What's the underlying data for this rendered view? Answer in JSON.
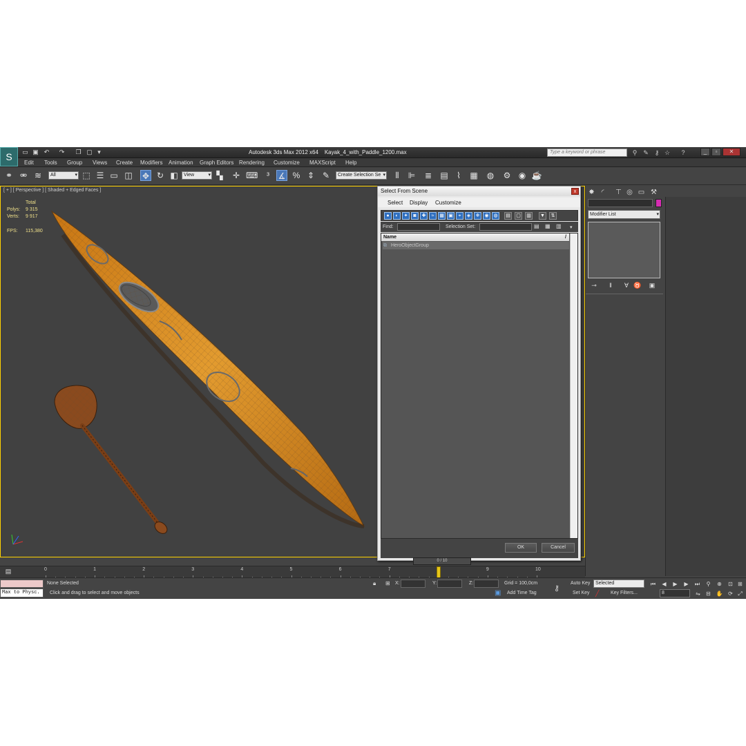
{
  "window": {
    "app_title": "Autodesk 3ds Max  2012 x64",
    "file_name": "Kayak_4_with_Paddle_1200.max",
    "search_placeholder": "Type a keyword or phrase"
  },
  "menus": [
    "Edit",
    "Tools",
    "Group",
    "Views",
    "Create",
    "Modifiers",
    "Animation",
    "Graph Editors",
    "Rendering",
    "Customize",
    "MAXScript",
    "Help"
  ],
  "toolbar": {
    "filter_value": "All",
    "coord_system": "View",
    "selection_set_value": "Create Selection Se"
  },
  "viewport": {
    "label": "[ + ] [ Perspective ] [ Shaded + Edged Faces ]",
    "stats": {
      "total_label": "Total",
      "polys_label": "Polys:",
      "polys_value": "9 315",
      "verts_label": "Verts:",
      "verts_value": "9 917",
      "fps_label": "FPS:",
      "fps_value": "115,380"
    }
  },
  "dialog": {
    "title": "Select From Scene",
    "close_label": "x",
    "menus": [
      "Select",
      "Display",
      "Customize"
    ],
    "find_label": "Find:",
    "selection_set_label": "Selection Set:",
    "column_name": "Name",
    "column_sort": "/",
    "rows": [
      "HeroObjectGroup"
    ],
    "ok_label": "OK",
    "cancel_label": "Cancel"
  },
  "command_panel": {
    "modifier_list": "Modifier List"
  },
  "timeline": {
    "slider_label": "0 / 10",
    "ticks": [
      "0",
      "1",
      "2",
      "3",
      "4",
      "5",
      "6",
      "7",
      "8",
      "9",
      "10"
    ],
    "current_frame": 8
  },
  "statusbar": {
    "maxscript_line": "Max to Physc.",
    "selection": "None Selected",
    "prompt": "Click and drag to select and move objects",
    "x_label": "X:",
    "y_label": "Y:",
    "z_label": "Z:",
    "grid": "Grid = 100,0cm",
    "add_time_tag": "Add Time Tag",
    "auto_key": "Auto Key",
    "set_key": "Set Key",
    "selected": "Selected",
    "key_filters": "Key Filters...",
    "frame": "8"
  },
  "colors": {
    "viewport_border": "#ffd200",
    "kayak": "#d98a1f",
    "paddle": "#8a4a1e",
    "active_tool": "#4a78b8",
    "object_color": "#d62db2"
  },
  "icons": [
    "app-logo-icon",
    "open-icon",
    "save-icon",
    "undo-icon",
    "redo-icon",
    "select-link-icon",
    "unlink-icon",
    "bind-space-warp-icon",
    "select-object-icon",
    "select-by-name-icon",
    "rect-selection-icon",
    "window-crossing-icon",
    "move-icon",
    "rotate-icon",
    "scale-icon",
    "snap-icon",
    "angle-snap-icon",
    "percent-snap-icon",
    "spinner-snap-icon",
    "mirror-icon",
    "align-icon",
    "layer-icon",
    "curve-editor-icon",
    "schematic-icon",
    "material-editor-icon",
    "render-setup-icon",
    "render-icon",
    "teapot-icon",
    "create-tab-icon",
    "modify-tab-icon",
    "hierarchy-tab-icon",
    "motion-tab-icon",
    "display-tab-icon",
    "utilities-tab-icon",
    "pin-stack-icon",
    "show-end-icon",
    "make-unique-icon",
    "remove-modifier-icon",
    "configure-icon",
    "lock-icon",
    "key-icon",
    "play-icon",
    "zoom-icon",
    "pan-icon",
    "orbit-icon"
  ]
}
